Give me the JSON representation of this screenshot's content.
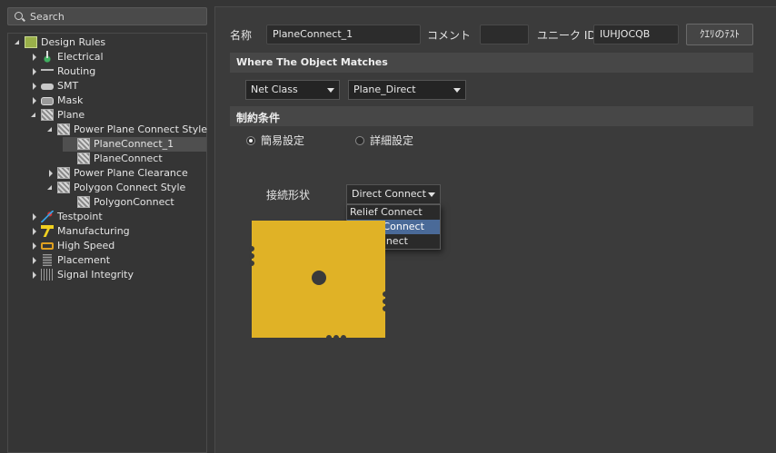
{
  "search": {
    "placeholder": "Search"
  },
  "tree": [
    {
      "label": "Design Rules",
      "icon": "design-rules-icon"
    },
    {
      "label": "Electrical",
      "icon": "electrical-icon"
    },
    {
      "label": "Routing",
      "icon": "routing-icon"
    },
    {
      "label": "SMT",
      "icon": "smt-icon"
    },
    {
      "label": "Mask",
      "icon": "mask-icon"
    },
    {
      "label": "Plane",
      "icon": "plane-icon"
    },
    {
      "label": "Power Plane Connect Style",
      "icon": "rule-icon"
    },
    {
      "label": "PlaneConnect_1",
      "icon": "rule-icon"
    },
    {
      "label": "PlaneConnect",
      "icon": "rule-icon"
    },
    {
      "label": "Power Plane Clearance",
      "icon": "rule-icon"
    },
    {
      "label": "Polygon Connect Style",
      "icon": "rule-icon"
    },
    {
      "label": "PolygonConnect",
      "icon": "rule-icon"
    },
    {
      "label": "Testpoint",
      "icon": "testpoint-icon"
    },
    {
      "label": "Manufacturing",
      "icon": "manufacturing-icon"
    },
    {
      "label": "High Speed",
      "icon": "high-speed-icon"
    },
    {
      "label": "Placement",
      "icon": "placement-icon"
    },
    {
      "label": "Signal Integrity",
      "icon": "signal-integrity-icon"
    }
  ],
  "form": {
    "name_label": "名称",
    "name_value": "PlaneConnect_1",
    "comment_label": "コメント",
    "comment_value": "",
    "uid_label": "ユニーク ID",
    "uid_value": "IUHJOCQB",
    "test_query_button": "ｸｴﾘのﾃｽﾄ"
  },
  "where": {
    "title": "Where The Object Matches",
    "type_select": "Net Class",
    "value_select": "Plane_Direct"
  },
  "constraints": {
    "title": "制約条件",
    "radio_simple": "簡易設定",
    "radio_advanced": "詳細設定",
    "connect_label": "接続形状",
    "connect_value": "Direct Connect",
    "options": [
      "Relief Connect",
      "Direct Connect",
      "No Connect"
    ]
  },
  "colors": {
    "plane": "#e0b226",
    "highlight": "#4a6a98"
  }
}
